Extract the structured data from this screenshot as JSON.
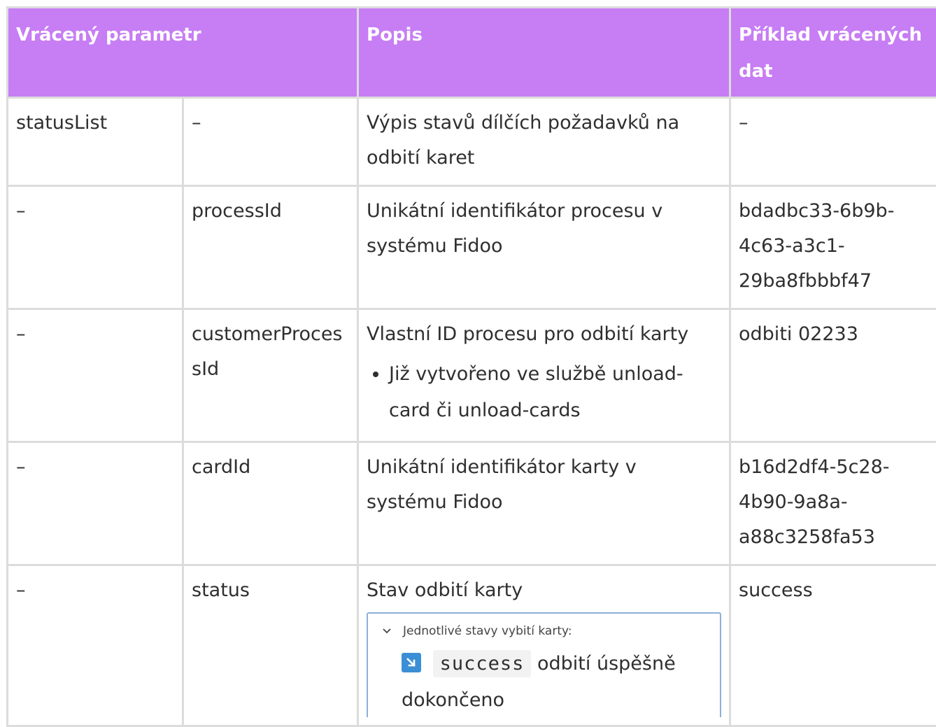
{
  "header": {
    "col1": "Vrácený parametr",
    "col2": "Popis",
    "col3": "Příklad vrácených dat"
  },
  "rows": [
    {
      "param": "statusList",
      "sub": "–",
      "desc": "Výpis stavů dílčích požadavků na odbití karet",
      "example": "–"
    },
    {
      "param": "–",
      "sub": "processId",
      "desc": "Unikátní identifikátor procesu v systému Fidoo",
      "example": "bdadbc33-6b9b-4c63-a3c1-29ba8fbbbf47"
    },
    {
      "param": "–",
      "sub": "customerProcessId",
      "desc": "Vlastní ID procesu pro odbití karty",
      "bullet": "Již vytvořeno ve službě unload-card či unload-cards",
      "example": "odbiti 02233"
    },
    {
      "param": "–",
      "sub": "cardId",
      "desc": "Unikátní identifikátor karty v systému Fidoo",
      "example": "b16d2df4-5c28-4b90-9a8a-a88c3258fa53"
    },
    {
      "param": "–",
      "sub": "status",
      "desc": "Stav odbití karty",
      "example": "success"
    }
  ],
  "expander": {
    "title": "Jednotlivé stavy vybití karty:",
    "code": "success",
    "text": "odbití úspěšně dokončeno"
  },
  "colors": {
    "header_bg": "#c77df4",
    "border": "#dcdcdc",
    "expander_border": "#8cb0dc",
    "badge": "#3b8fd6"
  }
}
